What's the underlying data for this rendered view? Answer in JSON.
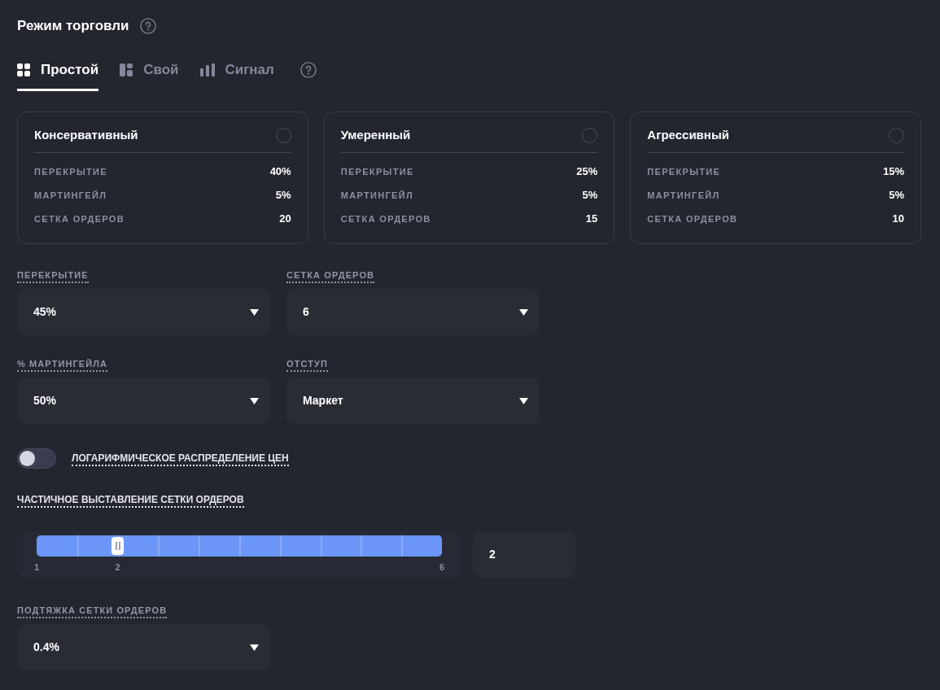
{
  "title": "Режим торговли",
  "tabs": [
    {
      "label": "Простой",
      "selected": true
    },
    {
      "label": "Свой",
      "selected": false
    },
    {
      "label": "Сигнал",
      "selected": false
    }
  ],
  "presets": [
    {
      "title": "Консервативный",
      "selected": false,
      "rows": [
        {
          "label": "ПЕРЕКРЫТИЕ",
          "value": "40%"
        },
        {
          "label": "МАРТИНГЕЙЛ",
          "value": "5%"
        },
        {
          "label": "СЕТКА ОРДЕРОВ",
          "value": "20"
        }
      ]
    },
    {
      "title": "Умеренный",
      "selected": false,
      "rows": [
        {
          "label": "ПЕРЕКРЫТИЕ",
          "value": "25%"
        },
        {
          "label": "МАРТИНГЕЙЛ",
          "value": "5%"
        },
        {
          "label": "СЕТКА ОРДЕРОВ",
          "value": "15"
        }
      ]
    },
    {
      "title": "Агрессивный",
      "selected": false,
      "rows": [
        {
          "label": "ПЕРЕКРЫТИЕ",
          "value": "15%"
        },
        {
          "label": "МАРТИНГЕЙЛ",
          "value": "5%"
        },
        {
          "label": "СЕТКА ОРДЕРОВ",
          "value": "10"
        }
      ]
    }
  ],
  "fields": [
    {
      "label": "ПЕРЕКРЫТИЕ",
      "value": "45%"
    },
    {
      "label": "СЕТКА ОРДЕРОВ",
      "value": "6"
    },
    {
      "label": "% МАРТИНГЕЙЛА",
      "value": "50%"
    },
    {
      "label": "ОТСТУП",
      "value": "Маркет"
    }
  ],
  "log_distribution": {
    "label": "ЛОГАРИФМИЧЕСКОЕ РАСПРЕДЕЛЕНИЕ ЦЕН",
    "on": false
  },
  "partial_orders": {
    "label": "ЧАСТИЧНОЕ ВЫСТАВЛЕНИЕ СЕТКИ ОРДЕРОВ",
    "level": 0.2,
    "min_label": "1",
    "thumb_label": "2",
    "max_label": "6",
    "value": "2"
  },
  "grid_pull": {
    "label": "ПОДТЯЖКА СЕТКИ ОРДЕРОВ",
    "value": "0.4%"
  }
}
